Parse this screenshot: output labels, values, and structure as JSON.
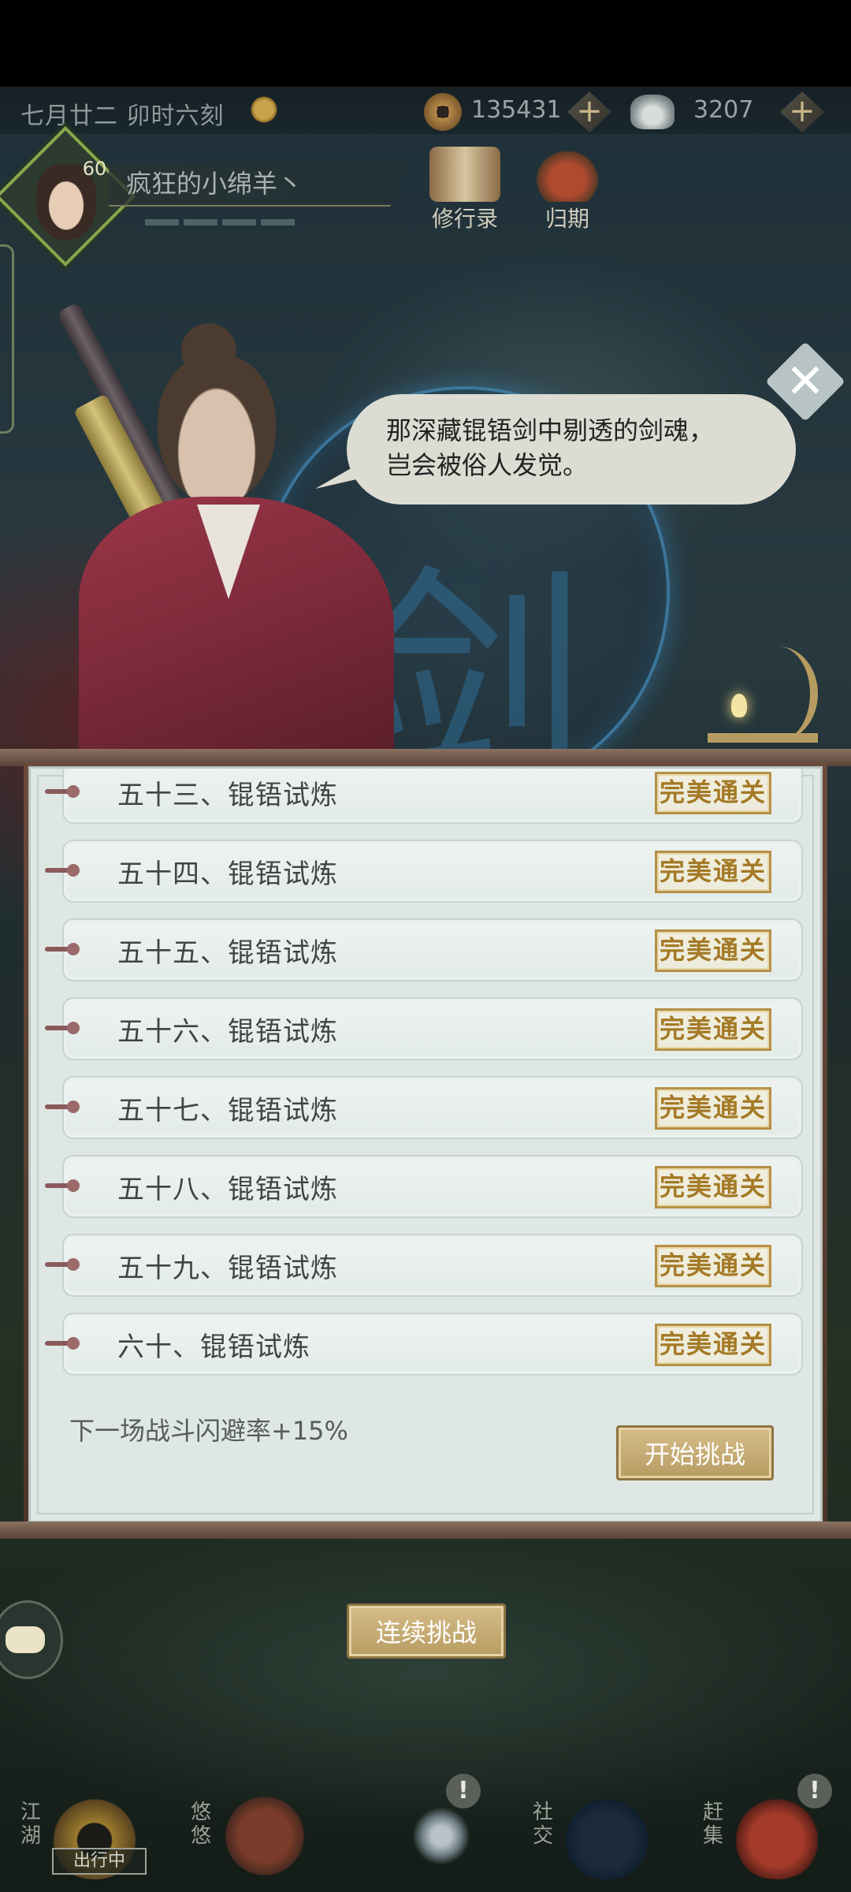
{
  "status": {
    "date_time": "七月廿二  卯时六刻",
    "coins": "135431",
    "silver": "3207",
    "plus": "+"
  },
  "player": {
    "level": "60",
    "name": "疯狂的小绵羊丶"
  },
  "top_icons": {
    "scroll_label": "修行录",
    "return_label": "归期"
  },
  "dialogue": {
    "line1": "那深藏锟铻剑中剔透的剑魂，",
    "line2": "岂会被俗人发觉。",
    "close": "✕"
  },
  "emblem_glyph": "剑",
  "stages": [
    {
      "name": "五十三、锟铻试炼",
      "badge": "完美通关"
    },
    {
      "name": "五十四、锟铻试炼",
      "badge": "完美通关"
    },
    {
      "name": "五十五、锟铻试炼",
      "badge": "完美通关"
    },
    {
      "name": "五十六、锟铻试炼",
      "badge": "完美通关"
    },
    {
      "name": "五十七、锟铻试炼",
      "badge": "完美通关"
    },
    {
      "name": "五十八、锟铻试炼",
      "badge": "完美通关"
    },
    {
      "name": "五十九、锟铻试炼",
      "badge": "完美通关"
    },
    {
      "name": "六十、锟铻试炼",
      "badge": "完美通关"
    }
  ],
  "bonus_text": "下一场战斗闪避率+15%",
  "buttons": {
    "start": "开始挑战",
    "continue": "连续挑战"
  },
  "nav": {
    "jianghu": "江湖",
    "jianghu_tag": "出行中",
    "youyou": "悠悠",
    "social": "社交",
    "market": "赶集",
    "alert": "!"
  }
}
